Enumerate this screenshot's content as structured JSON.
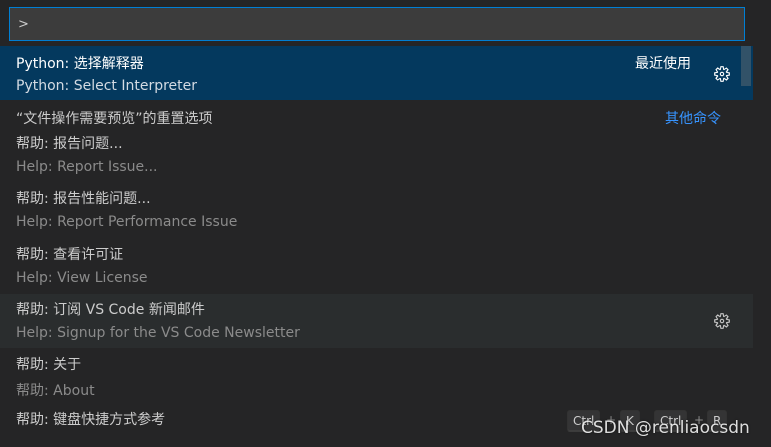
{
  "input": {
    "value": ">"
  },
  "items": [
    {
      "label": "Python: 选择解释器",
      "detail": "Python: Select Interpreter",
      "note": "最近使用",
      "gear": true
    },
    {
      "label": "“文件操作需要预览”的重置选项",
      "note": "其他命令"
    },
    {
      "label": "帮助: 报告问题...",
      "detail": "Help: Report Issue..."
    },
    {
      "label": "帮助: 报告性能问题...",
      "detail": "Help: Report Performance Issue"
    },
    {
      "label": "帮助: 查看许可证",
      "detail": "Help: View License"
    },
    {
      "label": "帮助: 订阅 VS Code 新闻邮件",
      "detail": "Help: Signup for the VS Code Newsletter",
      "gear": true
    },
    {
      "label": "帮助: 关于",
      "detail": "帮助: About"
    },
    {
      "label": "帮助: 键盘快捷方式参考",
      "keybinding": [
        "Ctrl",
        "+",
        "K",
        "Ctrl",
        "+",
        "R"
      ]
    }
  ],
  "watermark": "CSDN @renliaocsdn",
  "colors": {
    "selected_bg": "#04395e",
    "hover_bg": "#2a2d2e",
    "focus_border": "#007fd4",
    "link_blue": "#3794ff"
  },
  "icons": {
    "gear": "gear-icon"
  }
}
